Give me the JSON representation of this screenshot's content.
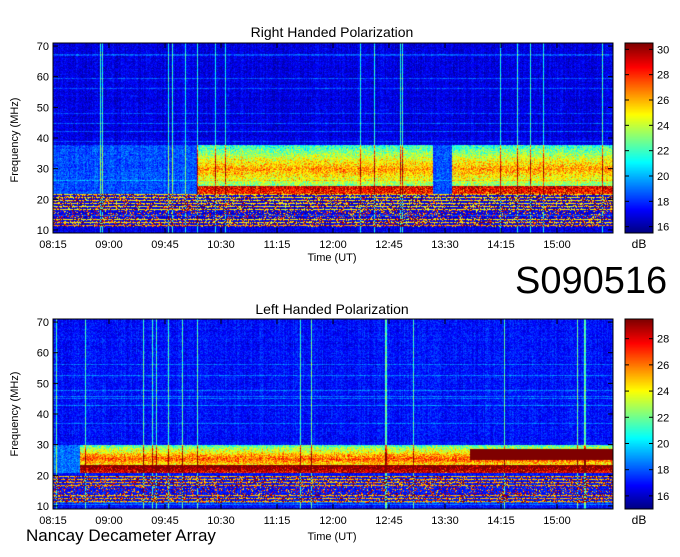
{
  "event_id": "S090516",
  "instrument": "Nancay Decameter Array",
  "colors": {
    "scale": [
      "#00007f",
      "#0000ff",
      "#0080ff",
      "#00ffff",
      "#80ff80",
      "#ffff00",
      "#ff8000",
      "#ff0000",
      "#7f0000"
    ],
    "background": "#ffffff"
  },
  "chart_data": [
    {
      "type": "heatmap",
      "title": "Right Handed Polarization",
      "xlabel": "Time (UT)",
      "ylabel": "Frequency (MHz)",
      "x_ticks": [
        "08:15",
        "09:00",
        "09:45",
        "10:30",
        "11:15",
        "12:00",
        "12:45",
        "13:30",
        "14:15",
        "15:00"
      ],
      "x_range_hours": [
        8.25,
        15.75
      ],
      "y_ticks": [
        10,
        20,
        30,
        40,
        50,
        60,
        70
      ],
      "ylim": [
        9,
        71
      ],
      "colorbar": {
        "label": "dB",
        "range": [
          15.5,
          30.5
        ],
        "ticks": [
          16,
          18,
          20,
          22,
          24,
          26,
          28,
          30
        ]
      },
      "description_features": {
        "background_db": 17,
        "low_freq_band_mhz": [
          11,
          22
        ],
        "bright_band_mhz": [
          22,
          38
        ],
        "event_start": "10:10",
        "gap_interval": [
          "13:20",
          "13:35"
        ]
      }
    },
    {
      "type": "heatmap",
      "title": "Left Handed Polarization",
      "xlabel": "Time (UT)",
      "ylabel": "Frequency (MHz)",
      "x_ticks": [
        "08:15",
        "09:00",
        "09:45",
        "10:30",
        "11:15",
        "12:00",
        "12:45",
        "13:30",
        "14:15",
        "15:00"
      ],
      "x_range_hours": [
        8.25,
        15.75
      ],
      "y_ticks": [
        10,
        20,
        30,
        40,
        50,
        60,
        70
      ],
      "ylim": [
        9,
        71
      ],
      "colorbar": {
        "label": "dB",
        "range": [
          15,
          29.5
        ],
        "ticks": [
          16,
          18,
          20,
          22,
          24,
          26,
          28
        ]
      },
      "description_features": {
        "background_db": 17,
        "low_freq_band_mhz": [
          11,
          20
        ],
        "bright_band_mhz": [
          21,
          30
        ],
        "late_burst_interval": [
          "13:50",
          "15:45"
        ]
      }
    }
  ]
}
